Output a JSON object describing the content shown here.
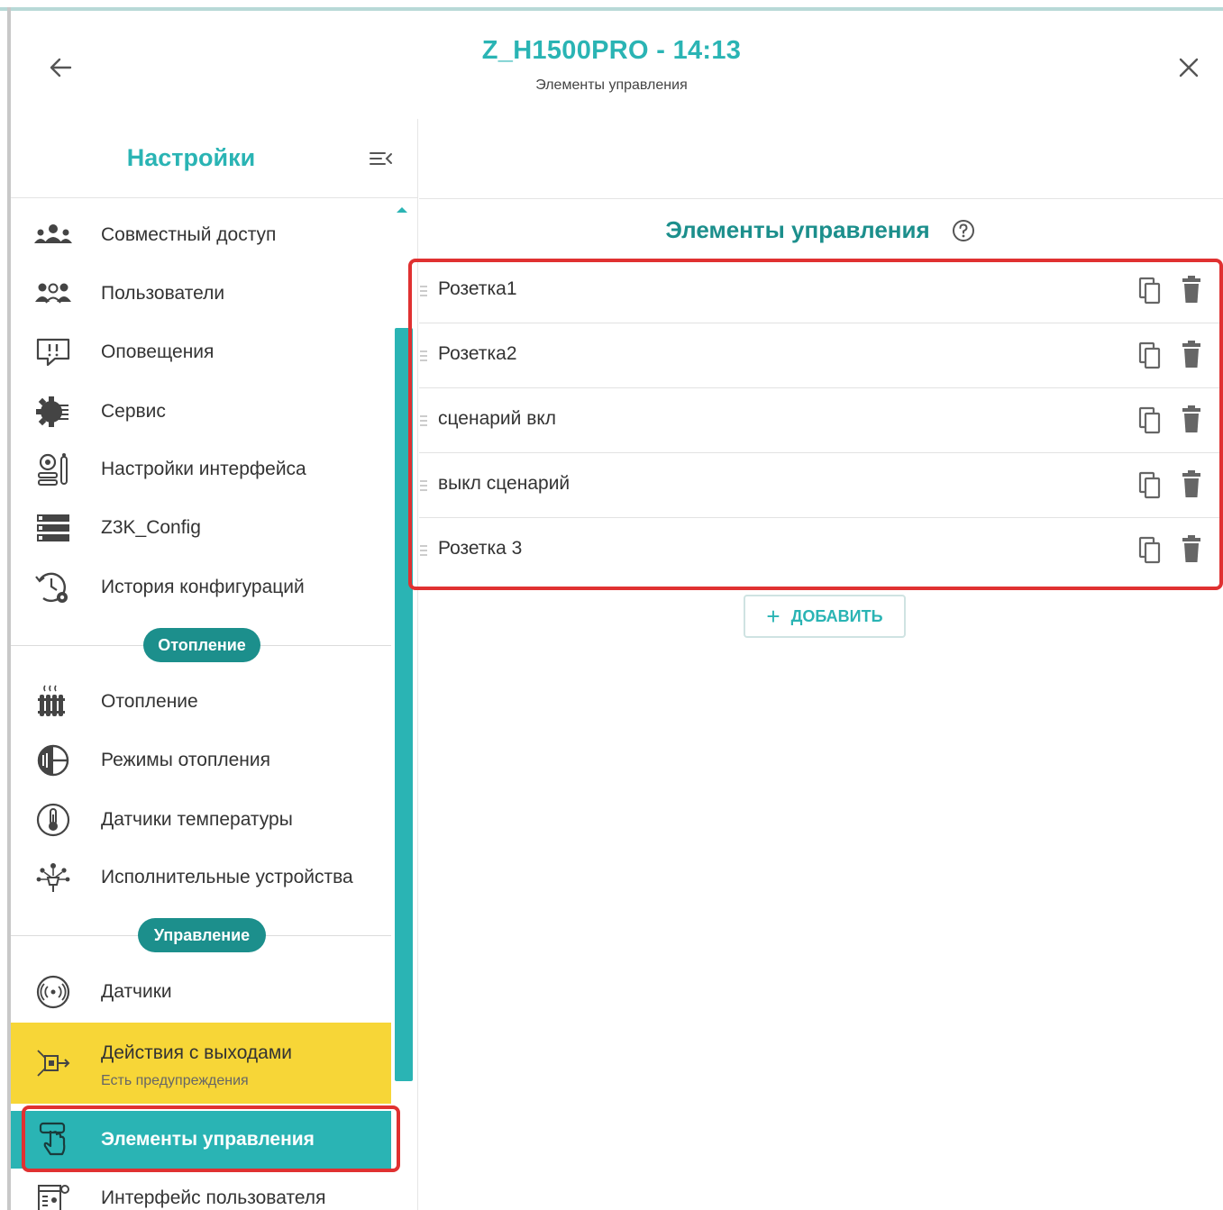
{
  "header": {
    "title": "Z_H1500PRO - 14:13",
    "subtitle": "Элементы управления"
  },
  "sidebar": {
    "title": "Настройки",
    "items": [
      {
        "label": "Совместный доступ",
        "icon": "shared-access-icon"
      },
      {
        "label": "Пользователи",
        "icon": "users-icon"
      },
      {
        "label": "Оповещения",
        "icon": "notifications-icon"
      },
      {
        "label": "Сервис",
        "icon": "service-gear-icon"
      },
      {
        "label": "Настройки интерфейса",
        "icon": "interface-settings-icon"
      },
      {
        "label": "Z3K_Config",
        "icon": "config-list-icon"
      },
      {
        "label": "История конфигураций",
        "icon": "config-history-icon"
      }
    ],
    "section_heating": "Отопление",
    "heating_items": [
      {
        "label": "Отопление",
        "icon": "radiator-icon"
      },
      {
        "label": "Режимы отопления",
        "icon": "heating-modes-icon"
      },
      {
        "label": "Датчики температуры",
        "icon": "thermometer-icon"
      },
      {
        "label": "Исполнительные устройства",
        "icon": "actuators-icon"
      }
    ],
    "section_control": "Управление",
    "control_items": [
      {
        "label": "Датчики",
        "icon": "sensors-icon"
      },
      {
        "label": "Действия с выходами",
        "sublabel": "Есть предупреждения",
        "icon": "output-actions-icon",
        "status_color": "#f7d637"
      },
      {
        "label": "Элементы управления",
        "icon": "touch-control-icon",
        "active": true
      },
      {
        "label": "Интерфейс пользователя",
        "icon": "user-interface-icon"
      }
    ]
  },
  "main": {
    "title": "Элементы управления",
    "rows": [
      {
        "label": "Розетка1"
      },
      {
        "label": "Розетка2"
      },
      {
        "label": "сценарий вкл"
      },
      {
        "label": "выкл сценарий"
      },
      {
        "label": "Розетка 3"
      }
    ],
    "add_label": "ДОБАВИТЬ",
    "add_symbol": "+"
  },
  "colors": {
    "accent": "#2ab4b4",
    "accent_dark": "#1c8f8c",
    "warning": "#f7d637",
    "highlight_box": "#e03131"
  }
}
